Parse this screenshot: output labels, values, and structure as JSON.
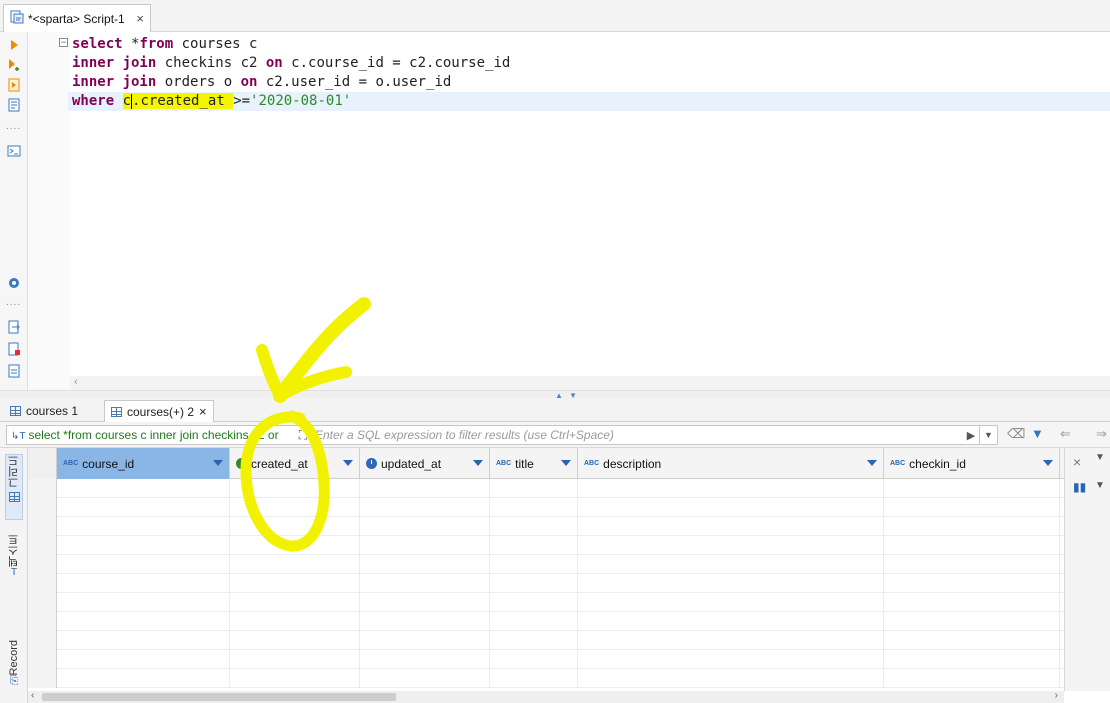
{
  "editor_tab": {
    "label": "*<sparta> Script-1",
    "close": "×"
  },
  "sql": {
    "line1": {
      "kw1": "select",
      "rest": " *",
      "kw2": "from",
      "rest2": " courses c"
    },
    "line2": {
      "kw1": "inner join",
      "mid": " checkins c2 ",
      "kw2": "on",
      "rest": " c.course_id = c2.course_id"
    },
    "line3": {
      "kw1": "inner join",
      "mid": " orders o ",
      "kw2": "on",
      "rest": " c2.user_id = o.user_id"
    },
    "line4": {
      "kw1": "where",
      "space": " ",
      "hl_pre": "c",
      "hl_post": ".created_at ",
      "op": ">=",
      "str": "'2020-08-01'"
    }
  },
  "result_tabs": [
    {
      "label": "courses 1"
    },
    {
      "label": "courses(+) 2",
      "close": "×"
    }
  ],
  "filter": {
    "query_text": "select *from courses c inner join checkins c2 or",
    "placeholder": "Enter a SQL expression to filter results (use Ctrl+Space)"
  },
  "columns": [
    {
      "name": "course_id",
      "type": "ABC"
    },
    {
      "name": "created_at",
      "type": "datetime"
    },
    {
      "name": "updated_at",
      "type": "datetime"
    },
    {
      "name": "title",
      "type": "ABC"
    },
    {
      "name": "description",
      "type": "ABC"
    },
    {
      "name": "checkin_id",
      "type": "ABC"
    }
  ],
  "vertical_tabs": {
    "grid": "그리드",
    "text": "텍스트",
    "record": "Record"
  },
  "colors": {
    "keyword": "#7f0055",
    "string": "#2a8c1f",
    "highlight": "#f5f500",
    "selected_header": "#8ab6e6",
    "accent": "#2a64b0"
  }
}
